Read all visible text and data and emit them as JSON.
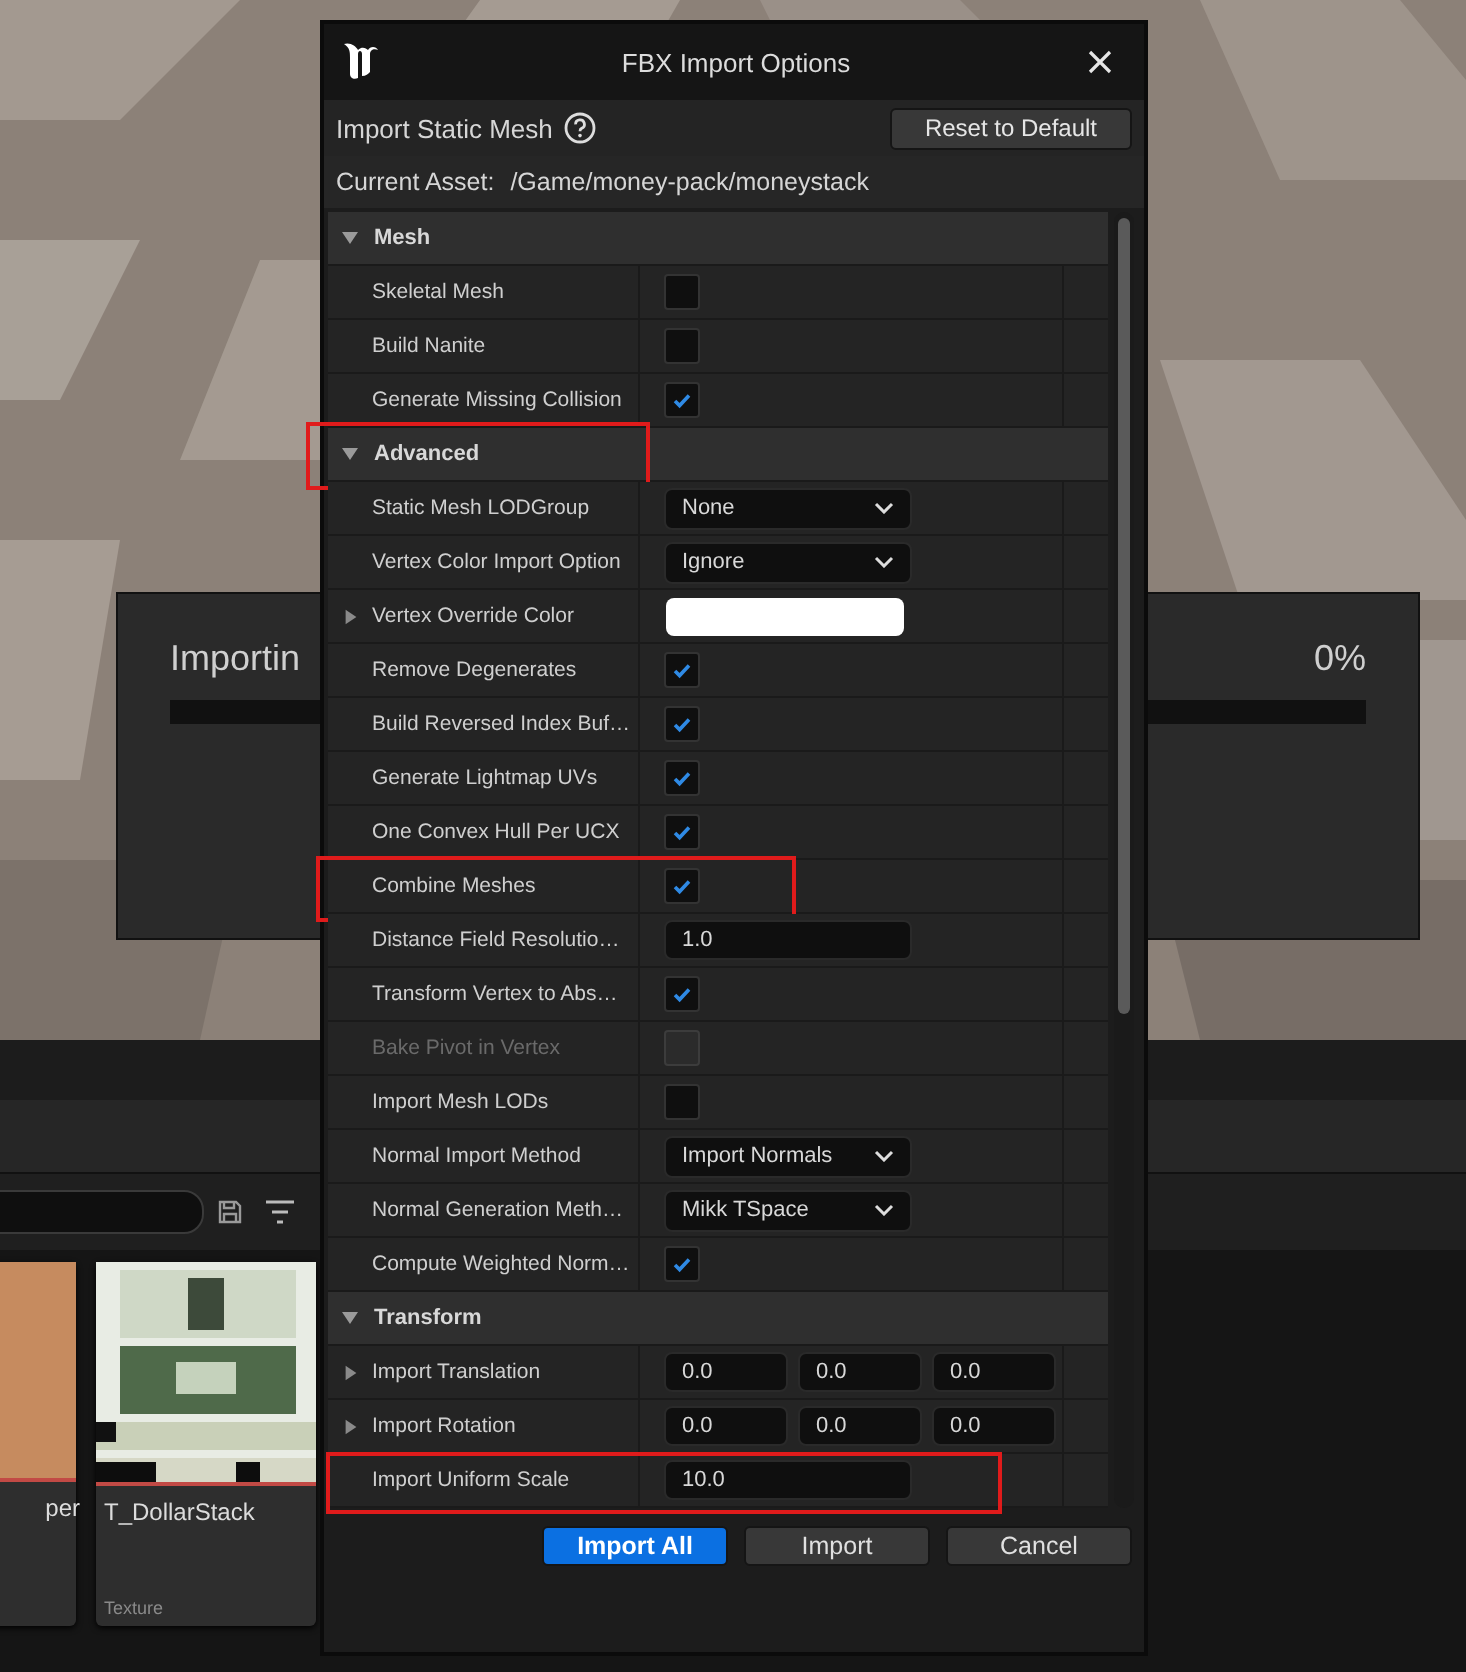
{
  "import_progress": {
    "label": "Importin",
    "percent": "0%",
    "level": 0
  },
  "content_browser": {
    "assets": [
      {
        "name": "per",
        "kind": "flat"
      },
      {
        "name": "T_DollarStack",
        "kind": "picture",
        "type": "Texture"
      }
    ]
  },
  "dialog": {
    "title": "FBX Import Options",
    "subtitle": "Import Static Mesh",
    "reset_button": "Reset to Default",
    "asset_label": "Current Asset:",
    "asset_path": "/Game/money-pack/moneystack",
    "sections": [
      {
        "title": "Mesh",
        "expanded": true,
        "highlighted": false,
        "rows": [
          {
            "label": "Skeletal Mesh",
            "kind": "checkbox",
            "checked": false
          },
          {
            "label": "Build Nanite",
            "kind": "checkbox",
            "checked": false
          },
          {
            "label": "Generate Missing Collision",
            "kind": "checkbox",
            "checked": true
          }
        ]
      },
      {
        "title": "Advanced",
        "expanded": true,
        "highlighted": true,
        "rows": [
          {
            "label": "Static Mesh LODGroup",
            "kind": "dropdown",
            "value": "None"
          },
          {
            "label": "Vertex Color Import Option",
            "kind": "dropdown",
            "value": "Ignore"
          },
          {
            "label": "Vertex Override Color",
            "kind": "color",
            "color": "#ffffff",
            "expanded": false
          },
          {
            "label": "Remove Degenerates",
            "kind": "checkbox",
            "checked": true
          },
          {
            "label": "Build Reversed Index Buf…",
            "kind": "checkbox",
            "checked": true
          },
          {
            "label": "Generate Lightmap UVs",
            "kind": "checkbox",
            "checked": true
          },
          {
            "label": "One Convex Hull Per UCX",
            "kind": "checkbox",
            "checked": true
          },
          {
            "label": "Combine Meshes",
            "kind": "checkbox",
            "checked": true,
            "highlighted": true
          },
          {
            "label": "Distance Field Resolutio…",
            "kind": "number",
            "value": "1.0"
          },
          {
            "label": "Transform Vertex to Abs…",
            "kind": "checkbox",
            "checked": true
          },
          {
            "label": "Bake Pivot in Vertex",
            "kind": "checkbox",
            "checked": false,
            "disabled": true
          },
          {
            "label": "Import Mesh LODs",
            "kind": "checkbox",
            "checked": false
          },
          {
            "label": "Normal Import Method",
            "kind": "dropdown",
            "value": "Import Normals"
          },
          {
            "label": "Normal Generation Meth…",
            "kind": "dropdown",
            "value": "Mikk TSpace"
          },
          {
            "label": "Compute Weighted Norm…",
            "kind": "checkbox",
            "checked": true
          }
        ]
      },
      {
        "title": "Transform",
        "expanded": true,
        "highlighted": false,
        "rows": [
          {
            "label": "Import Translation",
            "kind": "vector",
            "values": [
              "0.0",
              "0.0",
              "0.0"
            ],
            "expanded": false
          },
          {
            "label": "Import Rotation",
            "kind": "vector",
            "values": [
              "0.0",
              "0.0",
              "0.0"
            ],
            "expanded": false
          },
          {
            "label": "Import Uniform Scale",
            "kind": "number",
            "value": "10.0",
            "highlighted": true
          }
        ]
      }
    ],
    "buttons": [
      {
        "label": "Import All",
        "primary": true
      },
      {
        "label": "Import",
        "primary": false
      },
      {
        "label": "Cancel",
        "primary": false
      }
    ]
  }
}
